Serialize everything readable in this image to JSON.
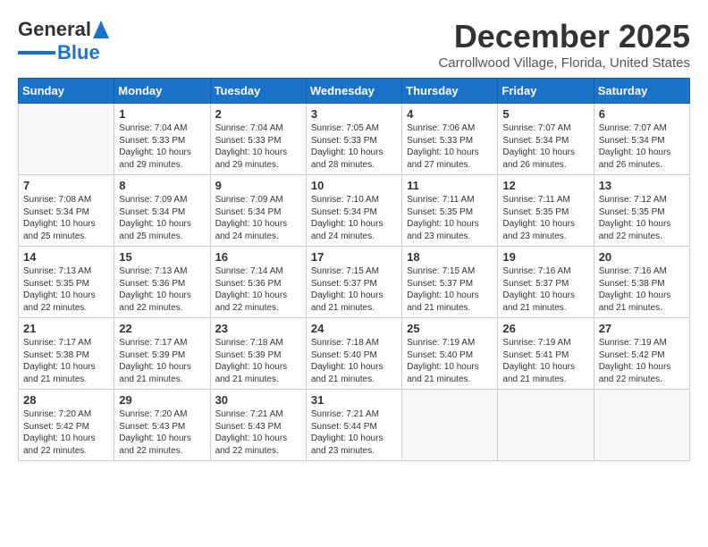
{
  "header": {
    "logo_general": "General",
    "logo_blue": "Blue",
    "month": "December 2025",
    "location": "Carrollwood Village, Florida, United States"
  },
  "weekdays": [
    "Sunday",
    "Monday",
    "Tuesday",
    "Wednesday",
    "Thursday",
    "Friday",
    "Saturday"
  ],
  "weeks": [
    [
      {
        "day": "",
        "info": ""
      },
      {
        "day": "1",
        "info": "Sunrise: 7:04 AM\nSunset: 5:33 PM\nDaylight: 10 hours\nand 29 minutes."
      },
      {
        "day": "2",
        "info": "Sunrise: 7:04 AM\nSunset: 5:33 PM\nDaylight: 10 hours\nand 29 minutes."
      },
      {
        "day": "3",
        "info": "Sunrise: 7:05 AM\nSunset: 5:33 PM\nDaylight: 10 hours\nand 28 minutes."
      },
      {
        "day": "4",
        "info": "Sunrise: 7:06 AM\nSunset: 5:33 PM\nDaylight: 10 hours\nand 27 minutes."
      },
      {
        "day": "5",
        "info": "Sunrise: 7:07 AM\nSunset: 5:34 PM\nDaylight: 10 hours\nand 26 minutes."
      },
      {
        "day": "6",
        "info": "Sunrise: 7:07 AM\nSunset: 5:34 PM\nDaylight: 10 hours\nand 26 minutes."
      }
    ],
    [
      {
        "day": "7",
        "info": "Sunrise: 7:08 AM\nSunset: 5:34 PM\nDaylight: 10 hours\nand 25 minutes."
      },
      {
        "day": "8",
        "info": "Sunrise: 7:09 AM\nSunset: 5:34 PM\nDaylight: 10 hours\nand 25 minutes."
      },
      {
        "day": "9",
        "info": "Sunrise: 7:09 AM\nSunset: 5:34 PM\nDaylight: 10 hours\nand 24 minutes."
      },
      {
        "day": "10",
        "info": "Sunrise: 7:10 AM\nSunset: 5:34 PM\nDaylight: 10 hours\nand 24 minutes."
      },
      {
        "day": "11",
        "info": "Sunrise: 7:11 AM\nSunset: 5:35 PM\nDaylight: 10 hours\nand 23 minutes."
      },
      {
        "day": "12",
        "info": "Sunrise: 7:11 AM\nSunset: 5:35 PM\nDaylight: 10 hours\nand 23 minutes."
      },
      {
        "day": "13",
        "info": "Sunrise: 7:12 AM\nSunset: 5:35 PM\nDaylight: 10 hours\nand 22 minutes."
      }
    ],
    [
      {
        "day": "14",
        "info": "Sunrise: 7:13 AM\nSunset: 5:35 PM\nDaylight: 10 hours\nand 22 minutes."
      },
      {
        "day": "15",
        "info": "Sunrise: 7:13 AM\nSunset: 5:36 PM\nDaylight: 10 hours\nand 22 minutes."
      },
      {
        "day": "16",
        "info": "Sunrise: 7:14 AM\nSunset: 5:36 PM\nDaylight: 10 hours\nand 22 minutes."
      },
      {
        "day": "17",
        "info": "Sunrise: 7:15 AM\nSunset: 5:37 PM\nDaylight: 10 hours\nand 21 minutes."
      },
      {
        "day": "18",
        "info": "Sunrise: 7:15 AM\nSunset: 5:37 PM\nDaylight: 10 hours\nand 21 minutes."
      },
      {
        "day": "19",
        "info": "Sunrise: 7:16 AM\nSunset: 5:37 PM\nDaylight: 10 hours\nand 21 minutes."
      },
      {
        "day": "20",
        "info": "Sunrise: 7:16 AM\nSunset: 5:38 PM\nDaylight: 10 hours\nand 21 minutes."
      }
    ],
    [
      {
        "day": "21",
        "info": "Sunrise: 7:17 AM\nSunset: 5:38 PM\nDaylight: 10 hours\nand 21 minutes."
      },
      {
        "day": "22",
        "info": "Sunrise: 7:17 AM\nSunset: 5:39 PM\nDaylight: 10 hours\nand 21 minutes."
      },
      {
        "day": "23",
        "info": "Sunrise: 7:18 AM\nSunset: 5:39 PM\nDaylight: 10 hours\nand 21 minutes."
      },
      {
        "day": "24",
        "info": "Sunrise: 7:18 AM\nSunset: 5:40 PM\nDaylight: 10 hours\nand 21 minutes."
      },
      {
        "day": "25",
        "info": "Sunrise: 7:19 AM\nSunset: 5:40 PM\nDaylight: 10 hours\nand 21 minutes."
      },
      {
        "day": "26",
        "info": "Sunrise: 7:19 AM\nSunset: 5:41 PM\nDaylight: 10 hours\nand 21 minutes."
      },
      {
        "day": "27",
        "info": "Sunrise: 7:19 AM\nSunset: 5:42 PM\nDaylight: 10 hours\nand 22 minutes."
      }
    ],
    [
      {
        "day": "28",
        "info": "Sunrise: 7:20 AM\nSunset: 5:42 PM\nDaylight: 10 hours\nand 22 minutes."
      },
      {
        "day": "29",
        "info": "Sunrise: 7:20 AM\nSunset: 5:43 PM\nDaylight: 10 hours\nand 22 minutes."
      },
      {
        "day": "30",
        "info": "Sunrise: 7:21 AM\nSunset: 5:43 PM\nDaylight: 10 hours\nand 22 minutes."
      },
      {
        "day": "31",
        "info": "Sunrise: 7:21 AM\nSunset: 5:44 PM\nDaylight: 10 hours\nand 23 minutes."
      },
      {
        "day": "",
        "info": ""
      },
      {
        "day": "",
        "info": ""
      },
      {
        "day": "",
        "info": ""
      }
    ]
  ]
}
